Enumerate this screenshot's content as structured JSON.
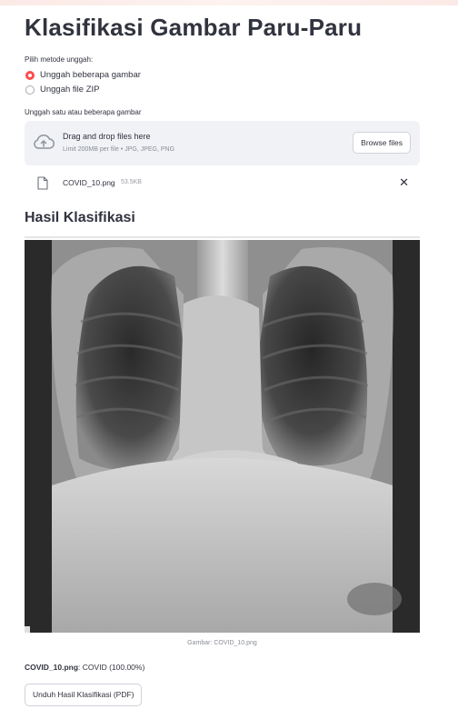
{
  "app": {
    "title": "Klasifikasi Gambar Paru-Paru"
  },
  "upload_method": {
    "label": "Pilih metode unggah:",
    "options": [
      {
        "label": "Unggah beberapa gambar",
        "selected": true
      },
      {
        "label": "Unggah file ZIP",
        "selected": false
      }
    ]
  },
  "uploader": {
    "label": "Unggah satu atau beberapa gambar",
    "drop_text": "Drag and drop files here",
    "limit_text": "Limit 200MB per file • JPG, JPEG, PNG",
    "browse_label": "Browse files",
    "icon": "cloud-upload-icon"
  },
  "uploaded_file": {
    "name": "COVID_10.png",
    "size": "53.5KB",
    "icon": "file-icon"
  },
  "results": {
    "header": "Hasil Klasifikasi",
    "image_caption": "Gambar: COVID_10.png",
    "filename": "COVID_10.png",
    "separator": ":",
    "prediction": "COVID (100.00%)",
    "download_label": "Unduh Hasil Klasifikasi (PDF)"
  },
  "colors": {
    "accent": "#ff4b4b",
    "dropzone_bg": "#f0f2f6",
    "text": "#31333f"
  }
}
